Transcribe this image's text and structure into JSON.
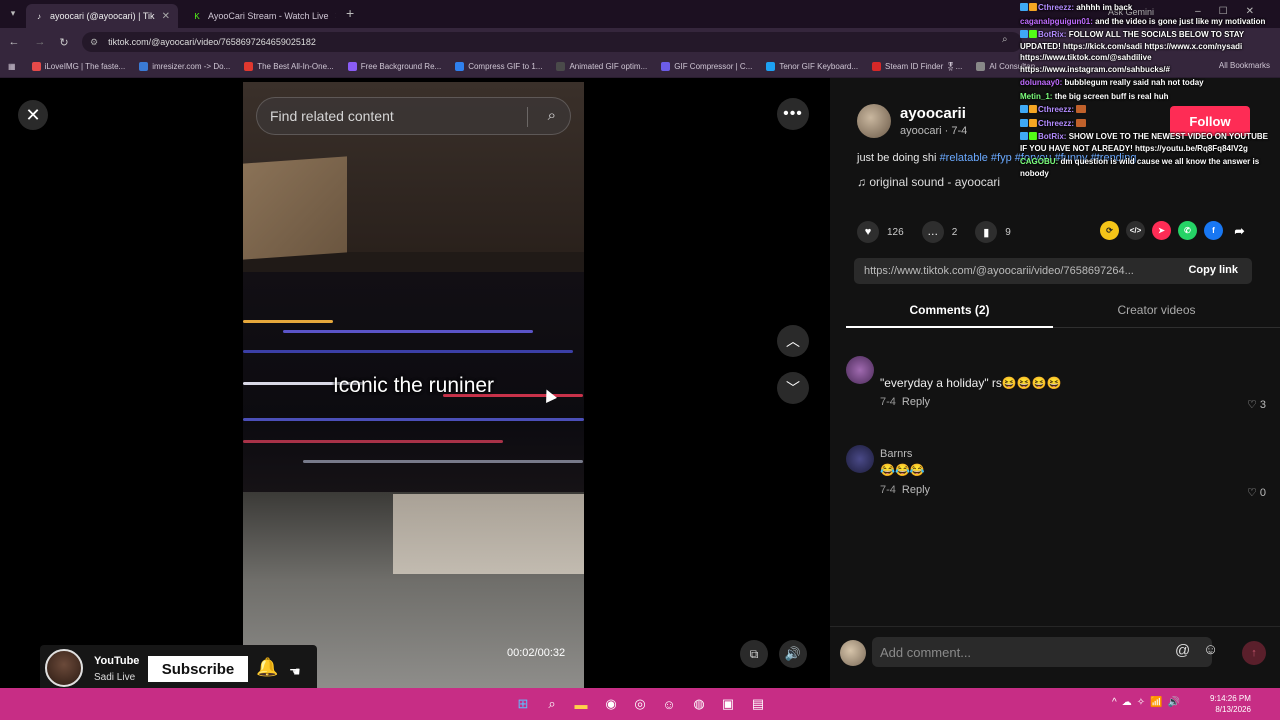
{
  "browser": {
    "tabs": [
      {
        "title": "ayoocari (@ayoocari) | Tik",
        "active": true
      },
      {
        "title": "AyooCari Stream - Watch Live",
        "active": false
      }
    ],
    "ask_gemini": "Ask Gemini",
    "url": "tiktok.com/@ayoocari/video/7658697264659025182",
    "bookmarks": [
      "iLoveIMG | The faste...",
      "imresizer.com -> Do...",
      "The Best All-In-One...",
      "Free Background Re...",
      "Compress GIF to 1...",
      "Animated GIF optim...",
      "GIF Compressor | C...",
      "Tenor GIF Keyboard...",
      "Steam ID Finder 🎖...",
      "AI Consultan"
    ],
    "all_bookmarks": "All Bookmarks"
  },
  "video": {
    "search_placeholder": "Find related content",
    "caption": "Iconic the runiner",
    "timecode": "00:02/00:32"
  },
  "creator": {
    "name": "ayoocarii",
    "sub": "ayoocari · 7-4",
    "follow_label": "Follow",
    "description": "just be doing shi",
    "hashtags": "#relatable #fyp #foryou #funny #trending",
    "sound": "♫  original sound - ayoocari"
  },
  "stats": {
    "likes": "126",
    "comments": "2",
    "saves": "9"
  },
  "link": {
    "url": "https://www.tiktok.com/@ayoocarii/video/7658697264...",
    "copy_label": "Copy link"
  },
  "tabs": {
    "comments": "Comments (2)",
    "creator_videos": "Creator videos"
  },
  "comments": [
    {
      "name": "",
      "text": "\"everyday a holiday\" rs😆😆😆😆",
      "date": "7-4",
      "reply": "Reply",
      "likes": "3"
    },
    {
      "name": "Barnrs",
      "text": "😂😂😂",
      "date": "7-4",
      "reply": "Reply",
      "likes": "0"
    }
  ],
  "add_comment_placeholder": "Add comment...",
  "chat": [
    {
      "user": "Cthreezz:",
      "msg": "ahhhh im back",
      "color": "#b38cff"
    },
    {
      "user": "caganalpguigun01:",
      "msg": "and the video is gone just like my motivation",
      "color": "#c06cff"
    },
    {
      "user": "BotRix:",
      "msg": "FOLLOW ALL THE SOCIALS BELOW TO STAY UPDATED! https://kick.com/sadi https://www.x.com/nysadi https://www.tiktok.com/@sahdilive https://www.instagram.com/sahbucks/#",
      "color": "#b38cff"
    },
    {
      "user": "dolunaay0:",
      "msg": "bubblegum really said nah not today",
      "color": "#c06cff"
    },
    {
      "user": "Metin_1:",
      "msg": "the big screen buff is real huh",
      "color": "#7dff7d"
    },
    {
      "user": "Cthreezz:",
      "msg": "",
      "color": "#b38cff"
    },
    {
      "user": "Cthreezz:",
      "msg": "",
      "color": "#b38cff"
    },
    {
      "user": "BotRix:",
      "msg": "SHOW LOVE TO THE NEWEST VIDEO ON YOUTUBE IF YOU HAVE NOT ALREADY! https://youtu.be/Rq8Fq84lV2g",
      "color": "#b38cff"
    },
    {
      "user": "CAGOBU:",
      "msg": "dm question is wild cause we all know the answer is nobody",
      "color": "#7dff7d"
    }
  ],
  "youtube_widget": {
    "brand": "YouTube",
    "channel": "Sadi Live",
    "subscribe_label": "Subscribe"
  },
  "taskbar": {
    "time": "9:14:26 PM",
    "date": "8/13/2026"
  },
  "colors": {
    "follow_red": "#fe2c55",
    "taskbar_pink": "#c72d85",
    "hashtag_blue": "#6aa9ff"
  }
}
